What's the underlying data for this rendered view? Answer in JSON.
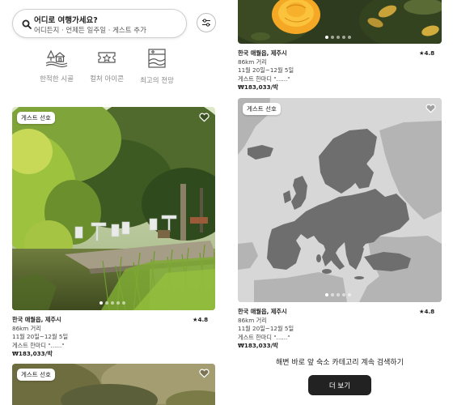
{
  "search": {
    "title": "어디로 여행가세요?",
    "subtitle": "어디든지 · 언제든 일주일 · 게스트 추가"
  },
  "categories": [
    {
      "label": "한적한 시골",
      "icon": "countryside-icon"
    },
    {
      "label": "컬처 아이콘",
      "icon": "culture-icon"
    },
    {
      "label": "최고의 전망",
      "icon": "view-icon"
    }
  ],
  "listings": [
    {
      "badge": "게스트 선호",
      "location": "한국 애월읍, 제주시",
      "distance": "86km 거리",
      "dates": "11월 20일~12월 5일",
      "host": "게스트 한마디 \"......\"",
      "price": "₩183,033/박",
      "rating": "★4.8"
    },
    {
      "badge": "게스트 선호",
      "location": "한국 애월읍, 제주시",
      "distance": "86km 거리",
      "dates": "11월 20일~12월 5일",
      "host": "게스트 한마디 \"......\"",
      "price": "₩183,033/박",
      "rating": "★4.8"
    },
    {
      "badge": "게스트 선호",
      "location": "한국 애월읍, 제주시",
      "distance": "86km 거리",
      "dates": "11월 20일~12월 5일",
      "host": "게스트 한마디 \"......\"",
      "price": "₩183,033/박",
      "rating": "★4.8"
    },
    {
      "badge": "게스트 선호"
    }
  ],
  "footer": {
    "continue_text": "해변 바로 앞 숙소 카테고리 계속 검색하기",
    "more_button": "더 보기"
  },
  "colors": {
    "accent": "#222222",
    "map_land": "#6e6e6e",
    "map_land_other": "#b4b4b4",
    "map_sea": "#d7d7d7"
  }
}
